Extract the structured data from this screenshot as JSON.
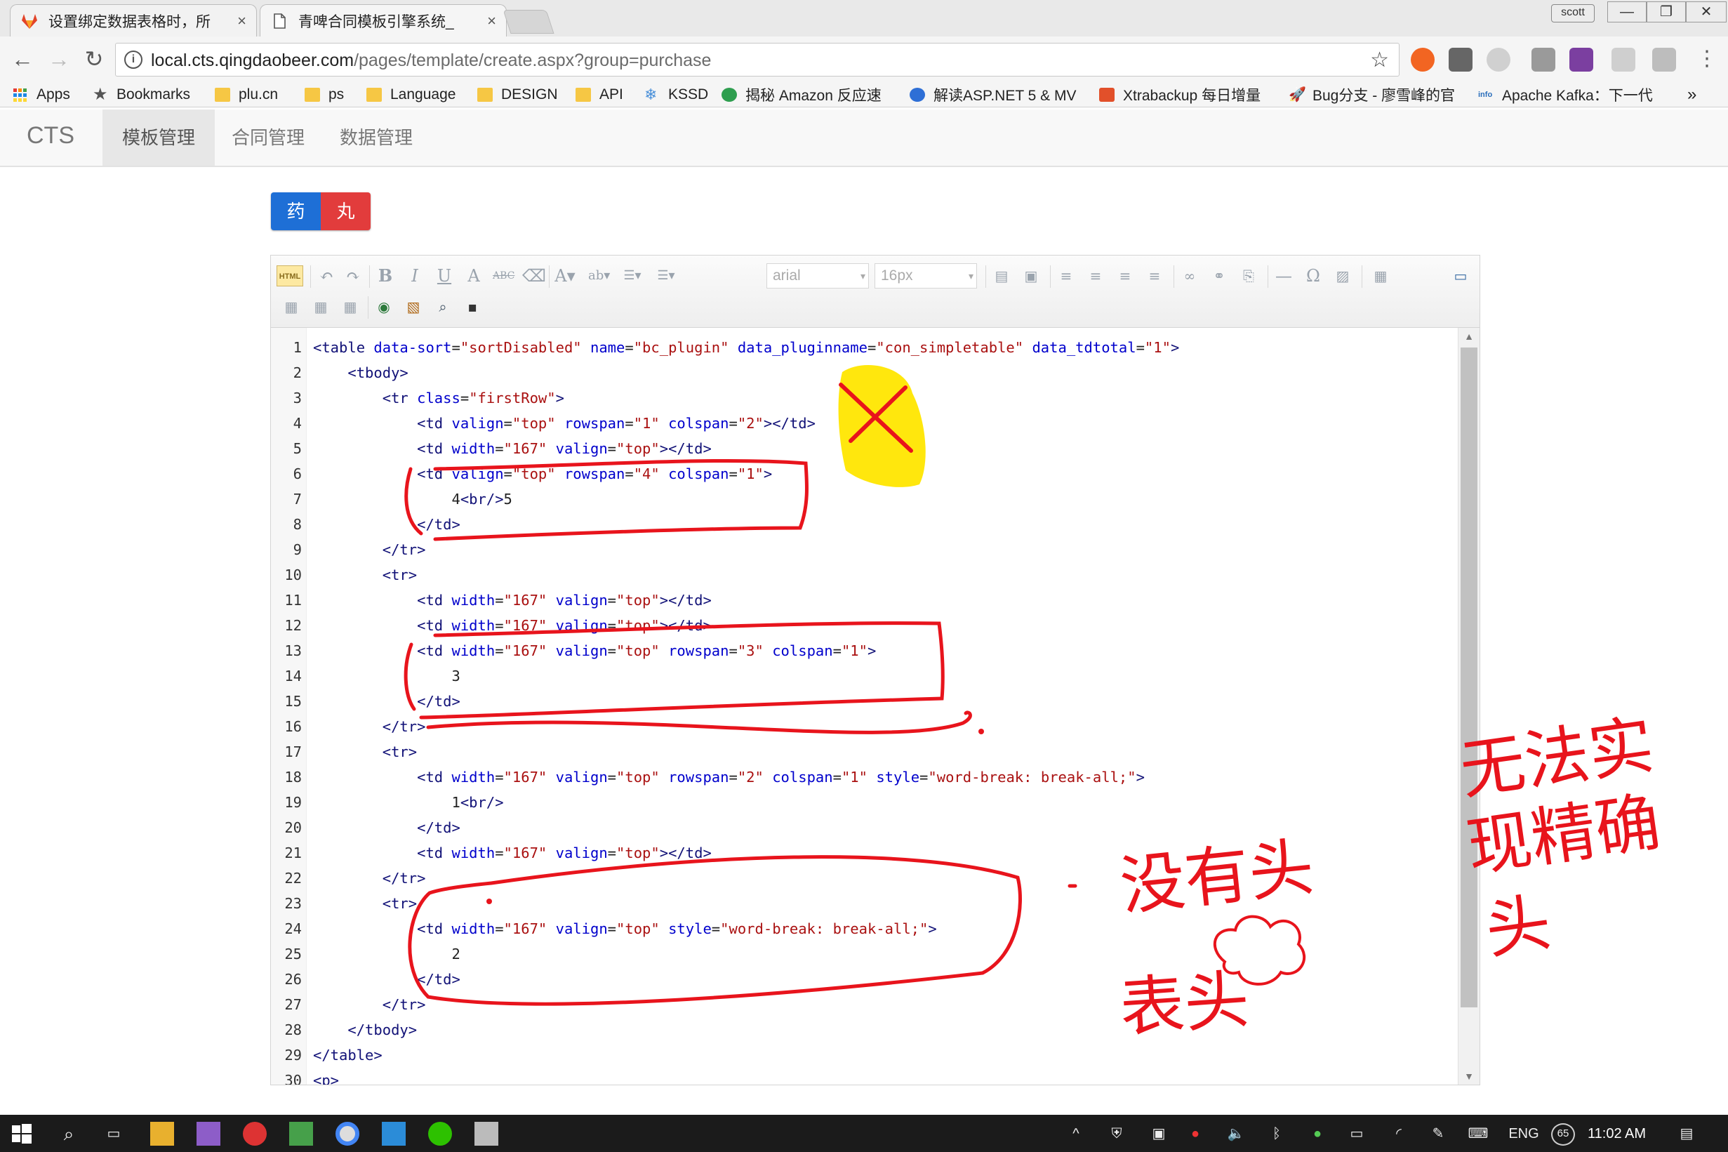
{
  "browser": {
    "tabs": [
      {
        "title": "设置绑定数据表格时，所",
        "close": "×",
        "active": false
      },
      {
        "title": "青啤合同模板引擎系统_",
        "close": "×",
        "active": true
      }
    ],
    "profile": "scott",
    "window_controls": {
      "minimize": "—",
      "restore": "❐",
      "close": "✕"
    },
    "url_host": "local.cts.qingdaobeer.com",
    "url_path": "/pages/template/create.aspx?group=purchase",
    "bookmarks": [
      {
        "label": "Apps",
        "icon": "apps-grid-icon"
      },
      {
        "label": "Bookmarks",
        "icon": "star-icon"
      },
      {
        "label": "plu.cn",
        "icon": "folder-icon"
      },
      {
        "label": "ps",
        "icon": "folder-icon"
      },
      {
        "label": "Language",
        "icon": "folder-icon"
      },
      {
        "label": "DESIGN",
        "icon": "folder-icon"
      },
      {
        "label": "API",
        "icon": "folder-icon"
      },
      {
        "label": "KSSD",
        "icon": "snowflake-icon"
      },
      {
        "label": "揭秘 Amazon 反应速",
        "icon": "c-icon"
      },
      {
        "label": "解读ASP.NET 5 & MV",
        "icon": "globe-icon"
      },
      {
        "label": "Xtrabackup 每日增量",
        "icon": "shield-icon"
      },
      {
        "label": "Bug分支 - 廖雪峰的官",
        "icon": "rocket-icon"
      },
      {
        "label": "Apache Kafka：下一代",
        "icon": "info-icon"
      }
    ],
    "bookmarks_overflow": "»"
  },
  "app": {
    "brand": "CTS",
    "menu": [
      "模板管理",
      "合同管理",
      "数据管理"
    ],
    "active_menu": 0,
    "pill": {
      "left": "药",
      "right": "丸"
    }
  },
  "editor": {
    "html_button": "HTML",
    "font_family": "arial",
    "font_size": "16px",
    "code_lines": [
      [
        [
          "t",
          "<table "
        ],
        [
          "a",
          "data-sort"
        ],
        [
          "p",
          "="
        ],
        [
          "v",
          "\"sortDisabled\""
        ],
        [
          "p",
          " "
        ],
        [
          "a",
          "name"
        ],
        [
          "p",
          "="
        ],
        [
          "v",
          "\"bc_plugin\""
        ],
        [
          "p",
          " "
        ],
        [
          "a",
          "data_pluginname"
        ],
        [
          "p",
          "="
        ],
        [
          "v",
          "\"con_simpletable\""
        ],
        [
          "p",
          " "
        ],
        [
          "a",
          "data_tdtotal"
        ],
        [
          "p",
          "="
        ],
        [
          "v",
          "\"1\""
        ],
        [
          "t",
          ">"
        ]
      ],
      [
        [
          "p",
          "    "
        ],
        [
          "t",
          "<tbody>"
        ]
      ],
      [
        [
          "p",
          "        "
        ],
        [
          "t",
          "<tr "
        ],
        [
          "a",
          "class"
        ],
        [
          "p",
          "="
        ],
        [
          "v",
          "\"firstRow\""
        ],
        [
          "t",
          ">"
        ]
      ],
      [
        [
          "p",
          "            "
        ],
        [
          "t",
          "<td "
        ],
        [
          "a",
          "valign"
        ],
        [
          "p",
          "="
        ],
        [
          "v",
          "\"top\""
        ],
        [
          "p",
          " "
        ],
        [
          "a",
          "rowspan"
        ],
        [
          "p",
          "="
        ],
        [
          "v",
          "\"1\""
        ],
        [
          "p",
          " "
        ],
        [
          "a",
          "colspan"
        ],
        [
          "p",
          "="
        ],
        [
          "v",
          "\"2\""
        ],
        [
          "t",
          "></td>"
        ]
      ],
      [
        [
          "p",
          "            "
        ],
        [
          "t",
          "<td "
        ],
        [
          "a",
          "width"
        ],
        [
          "p",
          "="
        ],
        [
          "v",
          "\"167\""
        ],
        [
          "p",
          " "
        ],
        [
          "a",
          "valign"
        ],
        [
          "p",
          "="
        ],
        [
          "v",
          "\"top\""
        ],
        [
          "t",
          "></td>"
        ]
      ],
      [
        [
          "p",
          "            "
        ],
        [
          "t",
          "<td "
        ],
        [
          "a",
          "valign"
        ],
        [
          "p",
          "="
        ],
        [
          "v",
          "\"top\""
        ],
        [
          "p",
          " "
        ],
        [
          "a",
          "rowspan"
        ],
        [
          "p",
          "="
        ],
        [
          "v",
          "\"4\""
        ],
        [
          "p",
          " "
        ],
        [
          "a",
          "colspan"
        ],
        [
          "p",
          "="
        ],
        [
          "v",
          "\"1\""
        ],
        [
          "t",
          ">"
        ]
      ],
      [
        [
          "p",
          "                4"
        ],
        [
          "t",
          "<br/>"
        ],
        [
          "p",
          "5"
        ]
      ],
      [
        [
          "p",
          "            "
        ],
        [
          "t",
          "</td>"
        ]
      ],
      [
        [
          "p",
          "        "
        ],
        [
          "t",
          "</tr>"
        ]
      ],
      [
        [
          "p",
          "        "
        ],
        [
          "t",
          "<tr>"
        ]
      ],
      [
        [
          "p",
          "            "
        ],
        [
          "t",
          "<td "
        ],
        [
          "a",
          "width"
        ],
        [
          "p",
          "="
        ],
        [
          "v",
          "\"167\""
        ],
        [
          "p",
          " "
        ],
        [
          "a",
          "valign"
        ],
        [
          "p",
          "="
        ],
        [
          "v",
          "\"top\""
        ],
        [
          "t",
          "></td>"
        ]
      ],
      [
        [
          "p",
          "            "
        ],
        [
          "t",
          "<td "
        ],
        [
          "a",
          "width"
        ],
        [
          "p",
          "="
        ],
        [
          "v",
          "\"167\""
        ],
        [
          "p",
          " "
        ],
        [
          "a",
          "valign"
        ],
        [
          "p",
          "="
        ],
        [
          "v",
          "\"top\""
        ],
        [
          "t",
          "></td>"
        ]
      ],
      [
        [
          "p",
          "            "
        ],
        [
          "t",
          "<td "
        ],
        [
          "a",
          "width"
        ],
        [
          "p",
          "="
        ],
        [
          "v",
          "\"167\""
        ],
        [
          "p",
          " "
        ],
        [
          "a",
          "valign"
        ],
        [
          "p",
          "="
        ],
        [
          "v",
          "\"top\""
        ],
        [
          "p",
          " "
        ],
        [
          "a",
          "rowspan"
        ],
        [
          "p",
          "="
        ],
        [
          "v",
          "\"3\""
        ],
        [
          "p",
          " "
        ],
        [
          "a",
          "colspan"
        ],
        [
          "p",
          "="
        ],
        [
          "v",
          "\"1\""
        ],
        [
          "t",
          ">"
        ]
      ],
      [
        [
          "p",
          "                3"
        ]
      ],
      [
        [
          "p",
          "            "
        ],
        [
          "t",
          "</td>"
        ]
      ],
      [
        [
          "p",
          "        "
        ],
        [
          "t",
          "</tr>"
        ]
      ],
      [
        [
          "p",
          "        "
        ],
        [
          "t",
          "<tr>"
        ]
      ],
      [
        [
          "p",
          "            "
        ],
        [
          "t",
          "<td "
        ],
        [
          "a",
          "width"
        ],
        [
          "p",
          "="
        ],
        [
          "v",
          "\"167\""
        ],
        [
          "p",
          " "
        ],
        [
          "a",
          "valign"
        ],
        [
          "p",
          "="
        ],
        [
          "v",
          "\"top\""
        ],
        [
          "p",
          " "
        ],
        [
          "a",
          "rowspan"
        ],
        [
          "p",
          "="
        ],
        [
          "v",
          "\"2\""
        ],
        [
          "p",
          " "
        ],
        [
          "a",
          "colspan"
        ],
        [
          "p",
          "="
        ],
        [
          "v",
          "\"1\""
        ],
        [
          "p",
          " "
        ],
        [
          "a",
          "style"
        ],
        [
          "p",
          "="
        ],
        [
          "v",
          "\"word-break: break-all;\""
        ],
        [
          "t",
          ">"
        ]
      ],
      [
        [
          "p",
          "                1"
        ],
        [
          "t",
          "<br/>"
        ]
      ],
      [
        [
          "p",
          "            "
        ],
        [
          "t",
          "</td>"
        ]
      ],
      [
        [
          "p",
          "            "
        ],
        [
          "t",
          "<td "
        ],
        [
          "a",
          "width"
        ],
        [
          "p",
          "="
        ],
        [
          "v",
          "\"167\""
        ],
        [
          "p",
          " "
        ],
        [
          "a",
          "valign"
        ],
        [
          "p",
          "="
        ],
        [
          "v",
          "\"top\""
        ],
        [
          "t",
          "></td>"
        ]
      ],
      [
        [
          "p",
          "        "
        ],
        [
          "t",
          "</tr>"
        ]
      ],
      [
        [
          "p",
          "        "
        ],
        [
          "t",
          "<tr>"
        ]
      ],
      [
        [
          "p",
          "            "
        ],
        [
          "t",
          "<td "
        ],
        [
          "a",
          "width"
        ],
        [
          "p",
          "="
        ],
        [
          "v",
          "\"167\""
        ],
        [
          "p",
          " "
        ],
        [
          "a",
          "valign"
        ],
        [
          "p",
          "="
        ],
        [
          "v",
          "\"top\""
        ],
        [
          "p",
          " "
        ],
        [
          "a",
          "style"
        ],
        [
          "p",
          "="
        ],
        [
          "v",
          "\"word-break: break-all;\""
        ],
        [
          "t",
          ">"
        ]
      ],
      [
        [
          "p",
          "                2"
        ]
      ],
      [
        [
          "p",
          "            "
        ],
        [
          "t",
          "</td>"
        ]
      ],
      [
        [
          "p",
          "        "
        ],
        [
          "t",
          "</tr>"
        ]
      ],
      [
        [
          "p",
          "    "
        ],
        [
          "t",
          "</tbody>"
        ]
      ],
      [
        [
          "t",
          "</table>"
        ]
      ],
      [
        [
          "t",
          "<p>"
        ]
      ]
    ]
  },
  "annotations": {
    "note_1": "没有头",
    "note_2": "表头",
    "note_3": "无法实现精确头"
  },
  "taskbar": {
    "language": "ENG",
    "battery_badge": "65",
    "time": "11:02 AM"
  },
  "colors": {
    "ink_red": "#e8141c",
    "highlighter": "#ffe600",
    "pill_blue": "#1e6fd6",
    "pill_red": "#e23c3c"
  }
}
